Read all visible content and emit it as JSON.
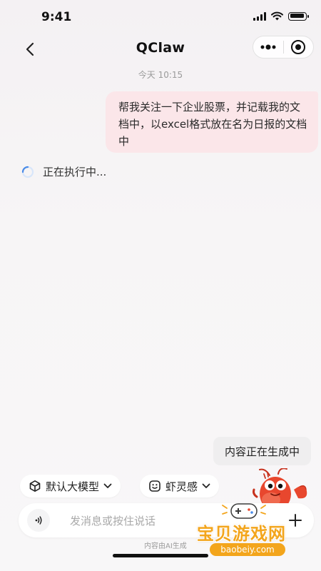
{
  "status_bar": {
    "time": "9:41"
  },
  "nav": {
    "title": "QClaw"
  },
  "chat": {
    "timestamp": "今天 10:15",
    "user_message": "帮我关注一下企业股票，并记载我的文档中，以excel格式放在名为日报的文档中",
    "running_text": "正在执行中..."
  },
  "generating_label": "内容正在生成中",
  "chips": {
    "model": "默认大模型",
    "inspire": "虾灵感"
  },
  "input": {
    "placeholder": "发消息或按住说话"
  },
  "disclaimer": "内容由AI生成",
  "watermark": {
    "title": "宝贝游戏网",
    "url": "baobeiy.com"
  },
  "colors": {
    "user_bubble": "#fbe6e9",
    "spinner": "#4a8be8",
    "mascot": "#e8472e",
    "watermark": "#f3a51c"
  },
  "icons": [
    "back-icon",
    "more-icon",
    "target-close-icon",
    "loading-spinner-icon",
    "cube-icon",
    "chevron-down-icon",
    "smile-face-icon",
    "voice-icon",
    "plus-icon",
    "crayfish-mascot"
  ]
}
